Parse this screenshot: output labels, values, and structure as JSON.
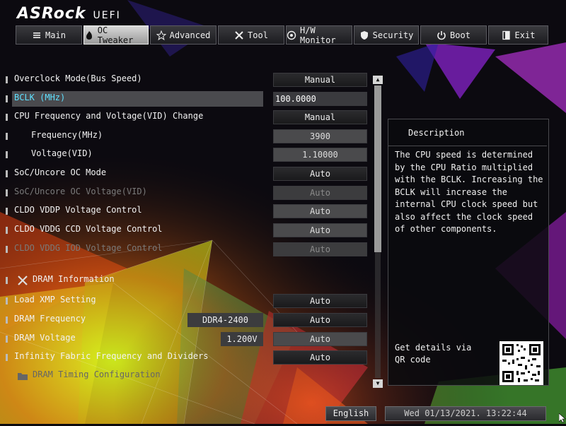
{
  "header": {
    "brand": "ASRock",
    "product": "UEFI"
  },
  "tabs": [
    {
      "label": "Main",
      "icon": "list-icon"
    },
    {
      "label": "OC Tweaker",
      "icon": "flame-icon",
      "active": true
    },
    {
      "label": "Advanced",
      "icon": "star-icon"
    },
    {
      "label": "Tool",
      "icon": "tools-icon"
    },
    {
      "label": "H/W Monitor",
      "icon": "monitor-icon"
    },
    {
      "label": "Security",
      "icon": "shield-icon"
    },
    {
      "label": "Boot",
      "icon": "power-icon"
    },
    {
      "label": "Exit",
      "icon": "exit-icon"
    }
  ],
  "settings": [
    {
      "label": "Overclock Mode(Bus Speed)",
      "value": "Manual"
    },
    {
      "label": "BCLK (MHz)",
      "value": "100.0000"
    },
    {
      "label": "CPU Frequency and Voltage(VID) Change",
      "value": "Manual"
    },
    {
      "label": "Frequency(MHz)",
      "value": "3900"
    },
    {
      "label": "Voltage(VID)",
      "value": "1.10000"
    },
    {
      "label": "SoC/Uncore OC Mode",
      "value": "Auto"
    },
    {
      "label": "SoC/Uncore OC Voltage(VID)",
      "value": "Auto"
    },
    {
      "label": "CLDO VDDP Voltage Control",
      "value": "Auto"
    },
    {
      "label": "CLDO VDDG CCD Voltage Control",
      "value": "Auto"
    },
    {
      "label": "CLDO VDDG IOD Voltage Control",
      "value": "Auto"
    },
    {
      "label": "DRAM Information"
    },
    {
      "label": "Load XMP Setting",
      "value": "Auto"
    },
    {
      "label": "DRAM Frequency",
      "value": "Auto",
      "info": "DDR4-2400"
    },
    {
      "label": "DRAM Voltage",
      "value": "Auto",
      "info": "1.200V"
    },
    {
      "label": "Infinity Fabric Frequency and Dividers",
      "value": "Auto"
    },
    {
      "label": "DRAM Timing Configuration"
    }
  ],
  "description": {
    "title": "Description",
    "text": "The CPU speed is determined by the CPU Ratio multiplied with the BCLK. Increasing the BCLK will increase the internal CPU clock speed but also affect the clock speed of other components.",
    "qr_text": "Get details via QR code"
  },
  "footer": {
    "language": "English",
    "datetime": "Wed 01/13/2021. 13:22:44"
  },
  "colors": {
    "accent": "#5fe0ff",
    "selected_row": "#4a4a4e",
    "active_tab": "#c8c8c8"
  }
}
